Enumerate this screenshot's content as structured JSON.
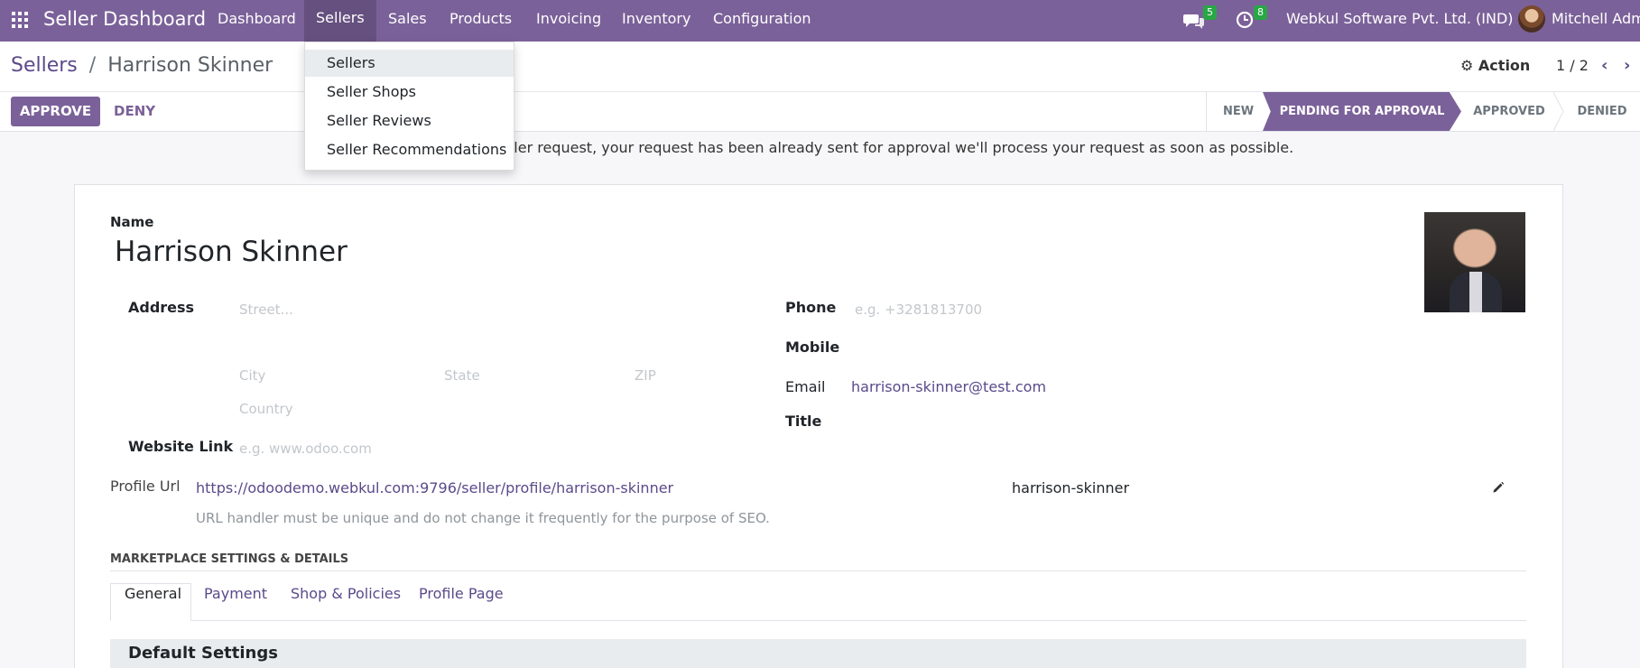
{
  "topbar": {
    "app_title": "Seller Dashboard",
    "menus": [
      "Dashboard",
      "Sellers",
      "Sales",
      "Products",
      "Invoicing",
      "Inventory",
      "Configuration"
    ],
    "messages_count": "5",
    "activities_count": "8",
    "company": "Webkul Software Pvt. Ltd. (IND)",
    "user": "Mitchell Admi"
  },
  "dropdown": {
    "items": [
      "Sellers",
      "Seller Shops",
      "Seller Reviews",
      "Seller Recommendations"
    ]
  },
  "control": {
    "breadcrumb_parent": "Sellers",
    "breadcrumb_sep": "/",
    "breadcrumb_current": "Harrison Skinner",
    "action_label": "Action",
    "pager": "1 / 2",
    "approve_label": "APPROVE",
    "deny_label": "DENY",
    "stages": [
      "NEW",
      "PENDING FOR APPROVAL",
      "APPROVED",
      "DENIED"
    ]
  },
  "notice": "eller request, your request has been already sent for approval we'll process your request as soon as possible.",
  "form": {
    "name_label": "Name",
    "name_value": "Harrison Skinner",
    "address_label": "Address",
    "street_ph": "Street...",
    "city_ph": "City",
    "state_ph": "State",
    "zip_ph": "ZIP",
    "country_ph": "Country",
    "website_label": "Website Link",
    "website_ph": "e.g. www.odoo.com",
    "phone_label": "Phone",
    "phone_ph": "e.g. +3281813700",
    "mobile_label": "Mobile",
    "email_label": "Email",
    "email_value": "harrison-skinner@test.com",
    "title_label": "Title",
    "profile_url_label": "Profile Url",
    "profile_url_value": "https://odoodemo.webkul.com:9796/seller/profile/harrison-skinner",
    "url_handler": "harrison-skinner",
    "url_help": "URL handler must be unique and do not change it frequently for the purpose of SEO.",
    "section_title": "MARKETPLACE SETTINGS & DETAILS",
    "tabs": [
      "General",
      "Payment",
      "Shop & Policies",
      "Profile Page"
    ],
    "default_settings": "Default Settings"
  },
  "colors": {
    "brand": "#7b6199",
    "badge": "#28a745",
    "link": "#5a4a8a"
  }
}
